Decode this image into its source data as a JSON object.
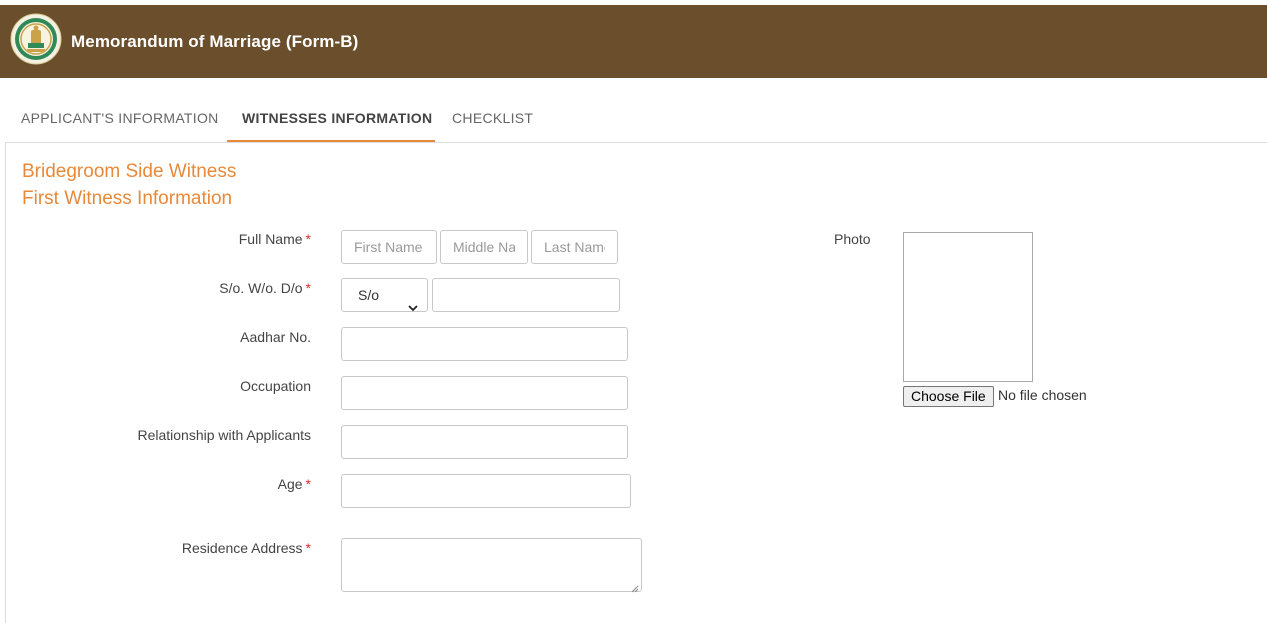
{
  "header": {
    "title": "Memorandum of Marriage (Form-B)",
    "logo_icon": "state-emblem-icon"
  },
  "tabs": [
    {
      "label": "APPLICANT'S INFORMATION",
      "active": false
    },
    {
      "label": "WITNESSES INFORMATION",
      "active": true
    },
    {
      "label": "CHECKLIST",
      "active": false
    }
  ],
  "section": {
    "title": "Bridegroom Side Witness",
    "subtitle": "First Witness Information"
  },
  "form": {
    "full_name": {
      "label": "Full Name",
      "required_mark": "*",
      "first_placeholder": "First Name",
      "middle_placeholder": "Middle Name",
      "last_placeholder": "Last Name",
      "first_value": "",
      "middle_value": "",
      "last_value": ""
    },
    "relation": {
      "label": "S/o. W/o. D/o",
      "required_mark": "*",
      "selected": "S/o",
      "value": ""
    },
    "aadhar": {
      "label": "Aadhar No.",
      "value": ""
    },
    "occupation": {
      "label": "Occupation",
      "value": ""
    },
    "relationship": {
      "label": "Relationship with Applicants",
      "value": ""
    },
    "age": {
      "label": "Age",
      "required_mark": "*",
      "value": ""
    },
    "address": {
      "label": "Residence Address",
      "required_mark": "*",
      "value": ""
    }
  },
  "photo": {
    "label": "Photo",
    "button_label": "Choose File",
    "status": "No file chosen"
  },
  "colors": {
    "header_bg": "#6b4f2c",
    "accent": "#e8893a",
    "required": "#d9302c"
  }
}
